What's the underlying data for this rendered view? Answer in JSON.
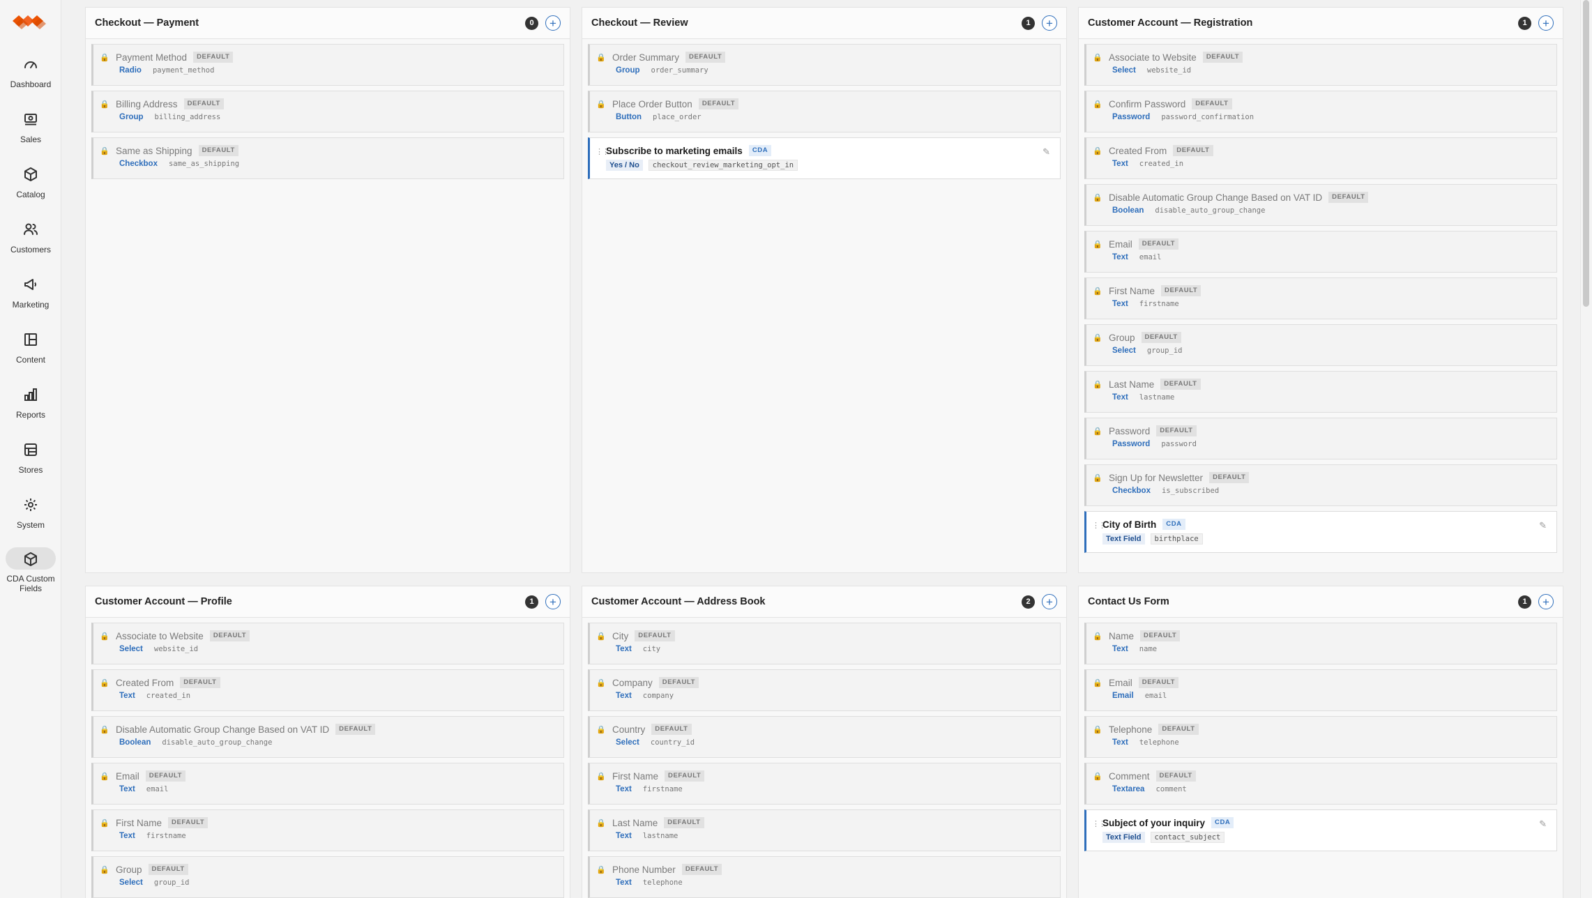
{
  "sidebar": {
    "items": [
      {
        "label": "Dashboard",
        "icon": "dashboard-icon"
      },
      {
        "label": "Sales",
        "icon": "sales-icon"
      },
      {
        "label": "Catalog",
        "icon": "catalog-icon"
      },
      {
        "label": "Customers",
        "icon": "customers-icon"
      },
      {
        "label": "Marketing",
        "icon": "marketing-icon"
      },
      {
        "label": "Content",
        "icon": "content-icon"
      },
      {
        "label": "Reports",
        "icon": "reports-icon"
      },
      {
        "label": "Stores",
        "icon": "stores-icon"
      },
      {
        "label": "System",
        "icon": "system-icon"
      },
      {
        "label": "CDA Custom Fields",
        "icon": "cda-custom-fields-icon",
        "active": true
      }
    ]
  },
  "labels": {
    "default": "DEFAULT",
    "cda": "CDA"
  },
  "colors": {
    "accent": "#2e6ebb",
    "brand": "#eb5202",
    "count_badge": "#333333"
  },
  "panels": [
    {
      "title": "Checkout — Payment",
      "count": "0",
      "fields": [
        {
          "name": "Payment Method",
          "type": "Radio",
          "code": "payment_method",
          "cda": false
        },
        {
          "name": "Billing Address",
          "type": "Group",
          "code": "billing_address",
          "cda": false
        },
        {
          "name": "Same as Shipping",
          "type": "Checkbox",
          "code": "same_as_shipping",
          "cda": false
        }
      ]
    },
    {
      "title": "Checkout — Review",
      "count": "1",
      "fields": [
        {
          "name": "Order Summary",
          "type": "Group",
          "code": "order_summary",
          "cda": false
        },
        {
          "name": "Place Order Button",
          "type": "Button",
          "code": "place_order",
          "cda": false
        },
        {
          "name": "Subscribe to marketing emails",
          "type": "Yes / No",
          "code": "checkout_review_marketing_opt_in",
          "cda": true
        }
      ]
    },
    {
      "title": "Customer Account — Registration",
      "count": "1",
      "fields": [
        {
          "name": "Associate to Website",
          "type": "Select",
          "code": "website_id",
          "cda": false
        },
        {
          "name": "Confirm Password",
          "type": "Password",
          "code": "password_confirmation",
          "cda": false
        },
        {
          "name": "Created From",
          "type": "Text",
          "code": "created_in",
          "cda": false
        },
        {
          "name": "Disable Automatic Group Change Based on VAT ID",
          "type": "Boolean",
          "code": "disable_auto_group_change",
          "cda": false
        },
        {
          "name": "Email",
          "type": "Text",
          "code": "email",
          "cda": false
        },
        {
          "name": "First Name",
          "type": "Text",
          "code": "firstname",
          "cda": false
        },
        {
          "name": "Group",
          "type": "Select",
          "code": "group_id",
          "cda": false
        },
        {
          "name": "Last Name",
          "type": "Text",
          "code": "lastname",
          "cda": false
        },
        {
          "name": "Password",
          "type": "Password",
          "code": "password",
          "cda": false
        },
        {
          "name": "Sign Up for Newsletter",
          "type": "Checkbox",
          "code": "is_subscribed",
          "cda": false
        },
        {
          "name": "City of Birth",
          "type": "Text Field",
          "code": "birthplace",
          "cda": true
        }
      ]
    },
    {
      "title": "Customer Account — Profile",
      "count": "1",
      "fields": [
        {
          "name": "Associate to Website",
          "type": "Select",
          "code": "website_id",
          "cda": false
        },
        {
          "name": "Created From",
          "type": "Text",
          "code": "created_in",
          "cda": false
        },
        {
          "name": "Disable Automatic Group Change Based on VAT ID",
          "type": "Boolean",
          "code": "disable_auto_group_change",
          "cda": false
        },
        {
          "name": "Email",
          "type": "Text",
          "code": "email",
          "cda": false
        },
        {
          "name": "First Name",
          "type": "Text",
          "code": "firstname",
          "cda": false
        },
        {
          "name": "Group",
          "type": "Select",
          "code": "group_id",
          "cda": false
        }
      ]
    },
    {
      "title": "Customer Account — Address Book",
      "count": "2",
      "fields": [
        {
          "name": "City",
          "type": "Text",
          "code": "city",
          "cda": false
        },
        {
          "name": "Company",
          "type": "Text",
          "code": "company",
          "cda": false
        },
        {
          "name": "Country",
          "type": "Select",
          "code": "country_id",
          "cda": false
        },
        {
          "name": "First Name",
          "type": "Text",
          "code": "firstname",
          "cda": false
        },
        {
          "name": "Last Name",
          "type": "Text",
          "code": "lastname",
          "cda": false
        },
        {
          "name": "Phone Number",
          "type": "Text",
          "code": "telephone",
          "cda": false
        }
      ]
    },
    {
      "title": "Contact Us Form",
      "count": "1",
      "fields": [
        {
          "name": "Name",
          "type": "Text",
          "code": "name",
          "cda": false
        },
        {
          "name": "Email",
          "type": "Email",
          "code": "email",
          "cda": false
        },
        {
          "name": "Telephone",
          "type": "Text",
          "code": "telephone",
          "cda": false
        },
        {
          "name": "Comment",
          "type": "Textarea",
          "code": "comment",
          "cda": false
        },
        {
          "name": "Subject of your inquiry",
          "type": "Text Field",
          "code": "contact_subject",
          "cda": true
        }
      ]
    }
  ]
}
